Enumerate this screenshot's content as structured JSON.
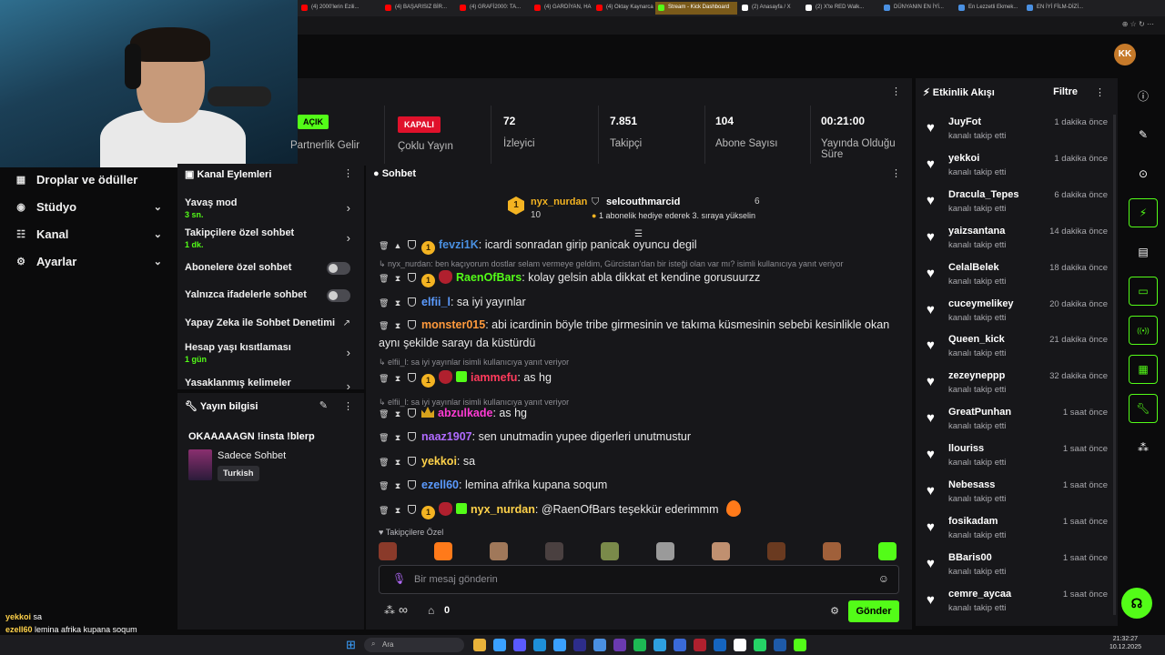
{
  "browser": {
    "tabs": [
      {
        "label": "(4) 2000'lerin Ezili...",
        "color": "#ff0000"
      },
      {
        "label": "(4) BAŞARISIZ BİR...",
        "color": "#ff0000"
      },
      {
        "label": "(4) GRAFİ2000: TA...",
        "color": "#ff0000"
      },
      {
        "label": "(4) GARDİYAN, HA...",
        "color": "#ff0000"
      },
      {
        "label": "(4) Oktay Kaynarca...",
        "color": "#ff0000"
      },
      {
        "label": "Stream - Kick Dashboard",
        "color": "#53fc18",
        "active": true
      },
      {
        "label": "(2) Anasayfa / X",
        "color": "#ffffff"
      },
      {
        "label": "(2) X'te RED Walk...",
        "color": "#ffffff"
      },
      {
        "label": "DÜNYANIN EN İYİ...",
        "color": "#4a90e2"
      },
      {
        "label": "En Lezzetli Ekmek...",
        "color": "#4a90e2"
      },
      {
        "label": "EN İYİ FİLM-DİZİ...",
        "color": "#4a90e2"
      }
    ]
  },
  "leftnav": {
    "items": [
      {
        "label": "Droplar ve ödüller",
        "icon": "gift-icon",
        "glyph": "▦",
        "chevron": false
      },
      {
        "label": "Stüdyo",
        "icon": "studio-icon",
        "glyph": "◉",
        "chevron": true
      },
      {
        "label": "Kanal",
        "icon": "channel-icon",
        "glyph": "☷",
        "chevron": true
      },
      {
        "label": "Ayarlar",
        "icon": "settings-icon",
        "glyph": "⚙",
        "chevron": true
      }
    ]
  },
  "stats": {
    "partnership": {
      "badge": "AÇIK",
      "label": "Partnerlik Gelir"
    },
    "multistream": {
      "badge": "KAPALI",
      "label": "Çoklu Yayın"
    },
    "viewers": {
      "value": "72",
      "label": "İzleyici"
    },
    "followers": {
      "value": "7.851",
      "label": "Takipçi"
    },
    "subs": {
      "value": "104",
      "label": "Abone Sayısı"
    },
    "duration": {
      "value": "00:21:00",
      "label": "Yayında Olduğu Süre"
    }
  },
  "actions": {
    "title": "Kanal Eylemleri",
    "items": [
      {
        "label": "Yavaş mod",
        "sub": "3 sn.",
        "type": "arrow"
      },
      {
        "label": "Takipçilere özel sohbet",
        "sub": "1 dk.",
        "type": "arrow"
      },
      {
        "label": "Abonelere özel sohbet",
        "sub": "",
        "type": "toggle"
      },
      {
        "label": "Yalnızca ifadelerle sohbet",
        "sub": "",
        "type": "toggle"
      },
      {
        "label": "Yapay Zeka ile Sohbet Denetimi",
        "sub": "",
        "type": "chart"
      },
      {
        "label": "Hesap yaşı kısıtlaması",
        "sub": "1 gün",
        "type": "arrow"
      },
      {
        "label": "Yasaklanmış kelimeler",
        "sub": "",
        "type": "arrow"
      }
    ]
  },
  "streaminfo": {
    "title": "Yayın bilgisi",
    "stream_title": "OKAAAAAGN !insta !blerp",
    "category": "Sadece Sohbet",
    "tag": "Turkish"
  },
  "chat": {
    "title": "Sohbet",
    "pinned": {
      "user1": "nyx_nurdan",
      "count1": "10",
      "user2": "selcouthmarcid",
      "count2": "6",
      "note": "1 abonelik hediye ederek 3. sıraya yükselin"
    },
    "messages": [
      {
        "user": "fevzi1K",
        "color": "#4a90e2",
        "text": "icardi sonradan girip panicak oyuncu degil",
        "badges": [
          "sub1"
        ]
      },
      {
        "reply": "nyx_nurdan: ben kaçıyorum dostlar selam vermeye geldim, Gürcistan'dan bir isteği olan var mı? isimli kullanıcıya yanıt veriyor"
      },
      {
        "user": "RaenOfBars",
        "color": "#53fc18",
        "text": "kolay gelsin abla dikkat et kendine gorusuurzz",
        "badges": [
          "sub1",
          "bull"
        ]
      },
      {
        "user": "elfii_l",
        "color": "#5b9bff",
        "text": "sa iyi yayınlar",
        "badges": []
      },
      {
        "user": "monster015",
        "color": "#ff9a3c",
        "text": "abi icardinin böyle tribe girmesinin ve takıma küsmesinin sebebi kesinlikle okan aynı şekilde sarayı da küstürdü",
        "badges": []
      },
      {
        "reply": "elfii_l: sa iyi yayınlar isimli kullanıcıya yanıt veriyor"
      },
      {
        "user": "iammefu",
        "color": "#ff3b5c",
        "text": "as hg",
        "badges": [
          "sub1",
          "bull",
          "gift"
        ]
      },
      {
        "reply": "elfii_l: sa iyi yayınlar isimli kullanıcıya yanıt veriyor"
      },
      {
        "user": "abzulkade",
        "color": "#ff3bd4",
        "text": "as hg",
        "badges": [
          "crown"
        ]
      },
      {
        "user": "naaz1907",
        "color": "#b06bff",
        "text": "sen unutmadin yupee digerleri unutmustur",
        "badges": []
      },
      {
        "user": "yekkoi",
        "color": "#ffd24a",
        "text": "sa",
        "badges": []
      },
      {
        "user": "ezell60",
        "color": "#5b9bff",
        "text": "lemina afrika kupana soqum",
        "badges": []
      },
      {
        "user": "nyx_nurdan",
        "color": "#ffd24a",
        "text": "@RaenOfBars teşekkür ederimmm",
        "badges": [
          "sub1",
          "bull",
          "gift"
        ],
        "heart": true
      }
    ],
    "followers_only_label": "Takipçilere Özel",
    "input_placeholder": "Bir mesaj gönderin",
    "points": "∞",
    "store_count": "0",
    "send_label": "Gönder"
  },
  "activity": {
    "title": "Etkinlik Akışı",
    "filter_label": "Filtre",
    "items": [
      {
        "user": "JuyFot",
        "action": "kanalı takip etti",
        "time": "1 dakika önce"
      },
      {
        "user": "yekkoi",
        "action": "kanalı takip etti",
        "time": "1 dakika önce"
      },
      {
        "user": "Dracula_Tepes",
        "action": "kanalı takip etti",
        "time": "6 dakika önce"
      },
      {
        "user": "yaizsantana",
        "action": "kanalı takip etti",
        "time": "14 dakika önce"
      },
      {
        "user": "CelalBelek",
        "action": "kanalı takip etti",
        "time": "18 dakika önce"
      },
      {
        "user": "cuceymelikey",
        "action": "kanalı takip etti",
        "time": "20 dakika önce"
      },
      {
        "user": "Queen_kick",
        "action": "kanalı takip etti",
        "time": "21 dakika önce"
      },
      {
        "user": "zezeyneppp",
        "action": "kanalı takip etti",
        "time": "32 dakika önce"
      },
      {
        "user": "GreatPunhan",
        "action": "kanalı takip etti",
        "time": "1 saat önce"
      },
      {
        "user": "llouriss",
        "action": "kanalı takip etti",
        "time": "1 saat önce"
      },
      {
        "user": "Nebesass",
        "action": "kanalı takip etti",
        "time": "1 saat önce"
      },
      {
        "user": "fosikadam",
        "action": "kanalı takip etti",
        "time": "1 saat önce"
      },
      {
        "user": "BBaris00",
        "action": "kanalı takip etti",
        "time": "1 saat önce"
      },
      {
        "user": "cemre_aycaa",
        "action": "kanalı takip etti",
        "time": "1 saat önce"
      }
    ]
  },
  "overlay": {
    "lines": [
      {
        "user": "yekkoi",
        "text": "sa"
      },
      {
        "user": "ezell60",
        "text": "lemina afrika kupana soqum"
      },
      {
        "user": "nyx_nurdan",
        "text": "@RaenOfBars teşekkür ederimmm"
      }
    ]
  },
  "taskbar": {
    "search": "Ara",
    "time": "21:32:27",
    "date": "10.12.2025"
  },
  "colors": {
    "accent": "#53fc18",
    "red": "#e0112b",
    "panel": "#17171a",
    "bg": "#0b0b0c"
  }
}
